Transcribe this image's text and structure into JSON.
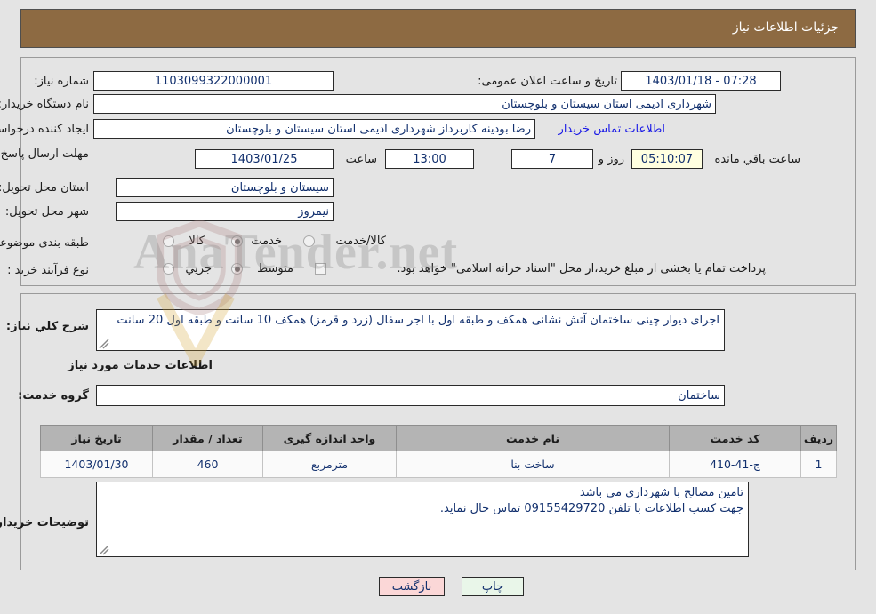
{
  "header": {
    "title": "جزئیات اطلاعات نیاز"
  },
  "form": {
    "need_number_label": "شماره نیاز:",
    "need_number_value": "1103099322000001",
    "public_announce_label": "تاریخ و ساعت اعلان عمومی:",
    "public_announce_value": "1403/01/18 - 07:28",
    "buyer_org_label": "نام دستگاه خریدار:",
    "buyer_org_value": "شهرداری ادیمی استان سیستان و بلوچستان",
    "requester_label": "ایجاد کننده درخواست:",
    "requester_value": "رضا بودینه کاربرداز شهرداری ادیمی استان سیستان و بلوچستان",
    "contact_link": "اطلاعات تماس خریدار",
    "deadline_label": "مهلت ارسال پاسخ: تا تاریخ:",
    "deadline_date": "1403/01/25",
    "hour_label": "ساعت",
    "deadline_time": "13:00",
    "days_value": "7",
    "days_label": "روز و",
    "countdown_value": "05:10:07",
    "countdown_label": "ساعت باقي مانده",
    "province_label": "استان محل تحویل:",
    "province_value": "سیستان و بلوچستان",
    "city_label": "شهر محل تحویل:",
    "city_value": "نیمروز",
    "category_label": "طبقه بندی موضوعی:",
    "category_options": [
      {
        "label": "کالا",
        "selected": false
      },
      {
        "label": "خدمت",
        "selected": true
      },
      {
        "label": "کالا/خدمت",
        "selected": false
      }
    ],
    "process_label": "نوع فرآیند خرید :",
    "process_options": [
      {
        "label": "جزیي",
        "selected": false
      },
      {
        "label": "متوسط",
        "selected": true
      }
    ],
    "treasury_checkbox_label": "پرداخت تمام یا بخشی از مبلغ خرید،از محل \"اسناد خزانه اسلامی\" خواهد بود."
  },
  "description": {
    "label": "شرح کلي نیاز:",
    "value": "اجرای دیوار چینی ساختمان آتش نشانی همکف و طبقه اول با اجر سفال (زرد و قرمز) همکف 10 سانت و طبقه اول 20 سانت"
  },
  "services": {
    "section_title": "اطلاعات خدمات مورد نیاز",
    "group_label": "گروه خدمت:",
    "group_value": "ساختمان",
    "columns": [
      "ردیف",
      "کد خدمت",
      "نام خدمت",
      "واحد اندازه گیری",
      "تعداد / مقدار",
      "تاریخ نیاز"
    ],
    "rows": [
      {
        "row_no": "1",
        "service_code": "ج-41-410",
        "service_name": "ساخت بنا",
        "unit": "مترمربع",
        "quantity": "460",
        "need_date": "1403/01/30"
      }
    ]
  },
  "buyer_notes": {
    "label": "توضیحات خریدار:",
    "line1": "تامین مصالح با شهرداری می باشد",
    "line2": "جهت کسب اطلاعات با تلفن 09155429720 تماس حال نماید."
  },
  "buttons": {
    "print": "چاپ",
    "back": "بازگشت"
  },
  "watermark": {
    "text": "AnaTender.net"
  },
  "colors": {
    "header_brown": "#8d6a42",
    "page_bg": "#e4e4e4",
    "link_blue": "#1a1ae6",
    "value_blue": "#12306e",
    "table_header_gray": "#b4b4b4",
    "countdown_yellow": "#ffffe0",
    "print_green": "#e9f6e9",
    "back_pink": "#fbd7d7"
  }
}
